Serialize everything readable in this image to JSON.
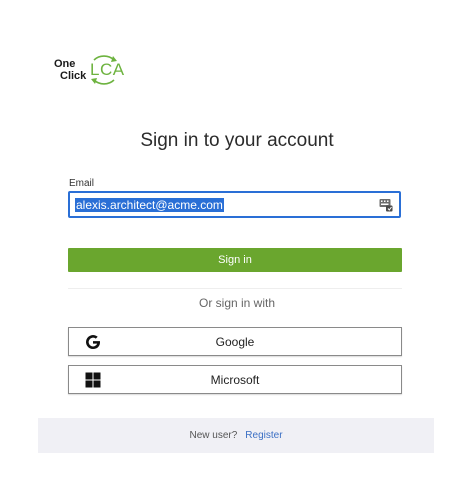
{
  "logo": {
    "line1": "One",
    "line2": "Click",
    "mark": "LCA",
    "accent_color": "#6db33f"
  },
  "heading": "Sign in to your account",
  "email": {
    "label": "Email",
    "value": "alexis.architect@acme.com",
    "icon": "keys-icon"
  },
  "signin_button": {
    "label": "Sign in",
    "color": "#6aa62e"
  },
  "divider_text": "Or sign in with",
  "social": {
    "google": {
      "label": "Google",
      "icon": "google-icon"
    },
    "microsoft": {
      "label": "Microsoft",
      "icon": "microsoft-icon"
    }
  },
  "footer": {
    "new_user_text": "New user?",
    "register_label": "Register",
    "link_color": "#3b6fc4"
  }
}
